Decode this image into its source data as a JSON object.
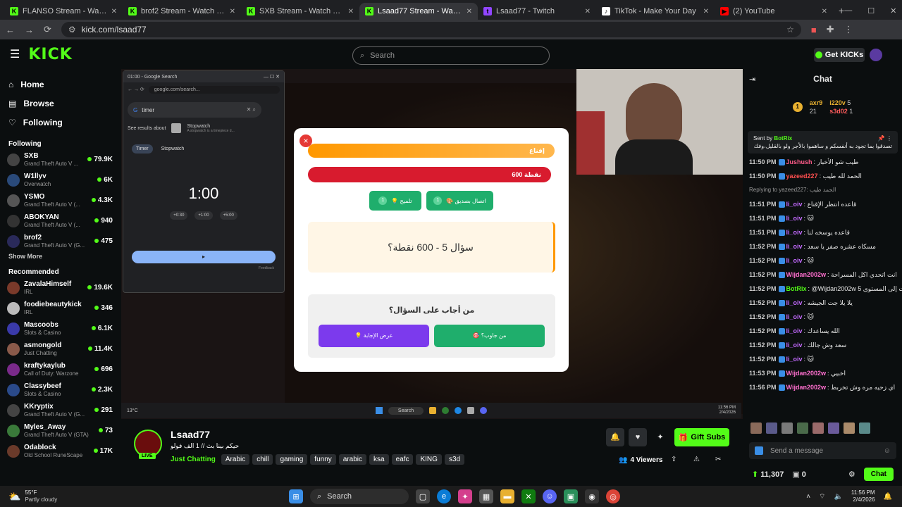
{
  "browser": {
    "tabs": [
      {
        "title": "FLANSO Stream - Watch Live o",
        "fav": "K",
        "color": "#53fc18"
      },
      {
        "title": "brof2 Stream - Watch Live on K",
        "fav": "K",
        "color": "#53fc18"
      },
      {
        "title": "SXB Stream - Watch Live on Ki",
        "fav": "K",
        "color": "#53fc18"
      },
      {
        "title": "Lsaad77 Stream - Watch Live o",
        "fav": "K",
        "color": "#53fc18",
        "active": true
      },
      {
        "title": "Lsaad77 - Twitch",
        "fav": "t",
        "color": "#9146ff"
      },
      {
        "title": "TikTok - Make Your Day",
        "fav": "♪",
        "color": "#ffffff"
      },
      {
        "title": "(2) YouTube",
        "fav": "▶",
        "color": "#ff0000"
      }
    ],
    "url": "kick.com/lsaad77"
  },
  "header": {
    "logo": "KICK",
    "search_placeholder": "Search",
    "get_kicks": "Get KICKs"
  },
  "sidebar": {
    "nav": [
      {
        "label": "Home",
        "icon": "home-icon"
      },
      {
        "label": "Browse",
        "icon": "browse-icon"
      },
      {
        "label": "Following",
        "icon": "heart-icon"
      }
    ],
    "following_title": "Following",
    "following": [
      {
        "name": "SXB",
        "category": "Grand Theft Auto V ...",
        "viewers": "79.9K",
        "color": "#444"
      },
      {
        "name": "W1llyv",
        "category": "Overwatch",
        "viewers": "6K",
        "color": "#2a4a7a"
      },
      {
        "name": "YSMO",
        "category": "Grand Theft Auto V (...",
        "viewers": "4.3K",
        "color": "#555"
      },
      {
        "name": "ABOKYAN",
        "category": "Grand Theft Auto V (...",
        "viewers": "940",
        "color": "#333"
      },
      {
        "name": "brof2",
        "category": "Grand Theft Auto V (G...",
        "viewers": "475",
        "color": "#2a2a5a"
      }
    ],
    "show_more": "Show More",
    "recommended_title": "Recommended",
    "recommended": [
      {
        "name": "ZavalaHimself",
        "category": "IRL",
        "viewers": "19.6K",
        "color": "#7a3a2a"
      },
      {
        "name": "foodiebeautykick",
        "category": "IRL",
        "viewers": "346",
        "color": "#bbb"
      },
      {
        "name": "Mascoobs",
        "category": "Slots & Casino",
        "viewers": "6.1K",
        "color": "#3a3aaa"
      },
      {
        "name": "asmongold",
        "category": "Just Chatting",
        "viewers": "11.4K",
        "color": "#8a5a4a"
      },
      {
        "name": "kraftykaylub",
        "category": "Call of Duty: Warzone",
        "viewers": "696",
        "color": "#7a2a8a"
      },
      {
        "name": "Classybeef",
        "category": "Slots & Casino",
        "viewers": "2.3K",
        "color": "#2a4a8a"
      },
      {
        "name": "KKryptix",
        "category": "Grand Theft Auto V (G...",
        "viewers": "291",
        "color": "#444"
      },
      {
        "name": "Myles_Away",
        "category": "Grand Theft Auto V (GTA)",
        "viewers": "73",
        "color": "#3a7a3a"
      },
      {
        "name": "Odablock",
        "category": "Old School RuneScape",
        "viewers": "17K",
        "color": "#6a3a2a"
      }
    ]
  },
  "google_window": {
    "tab_title": "01:00 - Google Search",
    "url": "google.com/search...",
    "query": "timer",
    "see_results": "See results about",
    "stopwatch_title": "Stopwatch",
    "stopwatch_sub": "A stopwatch is a timepiece d...",
    "timer_tab": "Timer",
    "stopwatch_tab": "Stopwatch",
    "time": "1:00",
    "presets": [
      "+0:30",
      "+1:00",
      "+5:00"
    ],
    "feedback": "Feedback"
  },
  "quiz": {
    "close": "×",
    "bar_orange": "إقناع",
    "bar_red": "600 نقطة",
    "btn1": "💡 تلميح",
    "btn1_count": "1",
    "btn2": "🎨 اتصال بصديق",
    "btn2_count": "1",
    "question": "سؤال 5 - 600 نقطة؟",
    "who_answered": "من أجاب على السؤال؟",
    "show_answer": "💡 عرض الإجابة",
    "who_answer": "🎯 من جاوب؟"
  },
  "stream_taskbar": {
    "weather": "13°C",
    "search": "Search",
    "time": "11:56 PM",
    "date": "2/4/2026"
  },
  "stream_info": {
    "name": "Lsaad77",
    "title": "حيكم بينا بث // 1 الف فولو",
    "live": "LIVE",
    "category": "Just Chatting",
    "tags": [
      "Arabic",
      "chill",
      "gaming",
      "funny",
      "arabic",
      "ksa",
      "eafc",
      "KING",
      "s3d"
    ],
    "viewers": "4 Viewers",
    "gift_subs": "Gift Subs"
  },
  "chat": {
    "title": "Chat",
    "leaders": [
      {
        "name": "axr9",
        "count": "1"
      },
      {
        "name": "i220v",
        "count": "5"
      },
      {
        "name": "",
        "count": "21"
      },
      {
        "name": "s3d02",
        "count": "1"
      }
    ],
    "pinned_by": "Sent by",
    "pinned_user": "BotRix",
    "pinned_text": "تصدقوا بما تجود به أنفسكم و ساهموا بالأجر ولو بالقليل،وفك يكتب لجزاكم جميعاً...",
    "messages": [
      {
        "time": "11:50 PM",
        "user": "Jushush",
        "color": "#ff5c8a",
        "text": "طيب شو الأخبار"
      },
      {
        "time": "11:50 PM",
        "user": "yazeed227",
        "color": "#ff4f4f",
        "text": "الحمد لله طيب"
      },
      {
        "time": "",
        "user": "",
        "color": "#aaa",
        "text": "Replying to yazeed227: الحمد طيب"
      },
      {
        "time": "11:51 PM",
        "user": "li_oiv",
        "color": "#c36aff",
        "text": "قاعده انتظر الإقناع"
      },
      {
        "time": "11:51 PM",
        "user": "li_oiv",
        "color": "#c36aff",
        "text": "🐱"
      },
      {
        "time": "11:51 PM",
        "user": "li_oiv",
        "color": "#c36aff",
        "text": "قاعده يوسخه لنا"
      },
      {
        "time": "11:52 PM",
        "user": "li_oiv",
        "color": "#c36aff",
        "text": "مسكاه عشره صفر يا سعد"
      },
      {
        "time": "11:52 PM",
        "user": "li_oiv",
        "color": "#c36aff",
        "text": "🐱"
      },
      {
        "time": "11:52 PM",
        "user": "Wijdan2002w",
        "color": "#ff6fcf",
        "text": "انت اتحدي اكل المسراحة"
      },
      {
        "time": "11:52 PM",
        "user": "BotRix",
        "color": "#53fc18",
        "text": "@Wijdan2002w مبروك! ارسلت إلى المستوى 5"
      },
      {
        "time": "11:52 PM",
        "user": "li_oiv",
        "color": "#c36aff",
        "text": "يلا يلا جت الجيشه"
      },
      {
        "time": "11:52 PM",
        "user": "li_oiv",
        "color": "#c36aff",
        "text": "🐱"
      },
      {
        "time": "11:52 PM",
        "user": "li_oiv",
        "color": "#c36aff",
        "text": "الله يساعدك"
      },
      {
        "time": "11:52 PM",
        "user": "li_oiv",
        "color": "#c36aff",
        "text": "سعد وش جالك"
      },
      {
        "time": "11:52 PM",
        "user": "li_oiv",
        "color": "#c36aff",
        "text": "🐱"
      },
      {
        "time": "11:53 PM",
        "user": "Wijdan2002w",
        "color": "#ff6fcf",
        "text": "اخبيي"
      },
      {
        "time": "11:56 PM",
        "user": "Wijdan2002w",
        "color": "#ff6fcf",
        "text": "اي زحيه مره وش تخربط"
      }
    ],
    "input_placeholder": "Send a message",
    "points": "11,307",
    "zero": "0",
    "chat_button": "Chat"
  },
  "os_taskbar": {
    "temp": "55°F",
    "weather": "Partly cloudy",
    "search": "Search",
    "time": "11:56 PM",
    "date": "2/4/2026"
  }
}
